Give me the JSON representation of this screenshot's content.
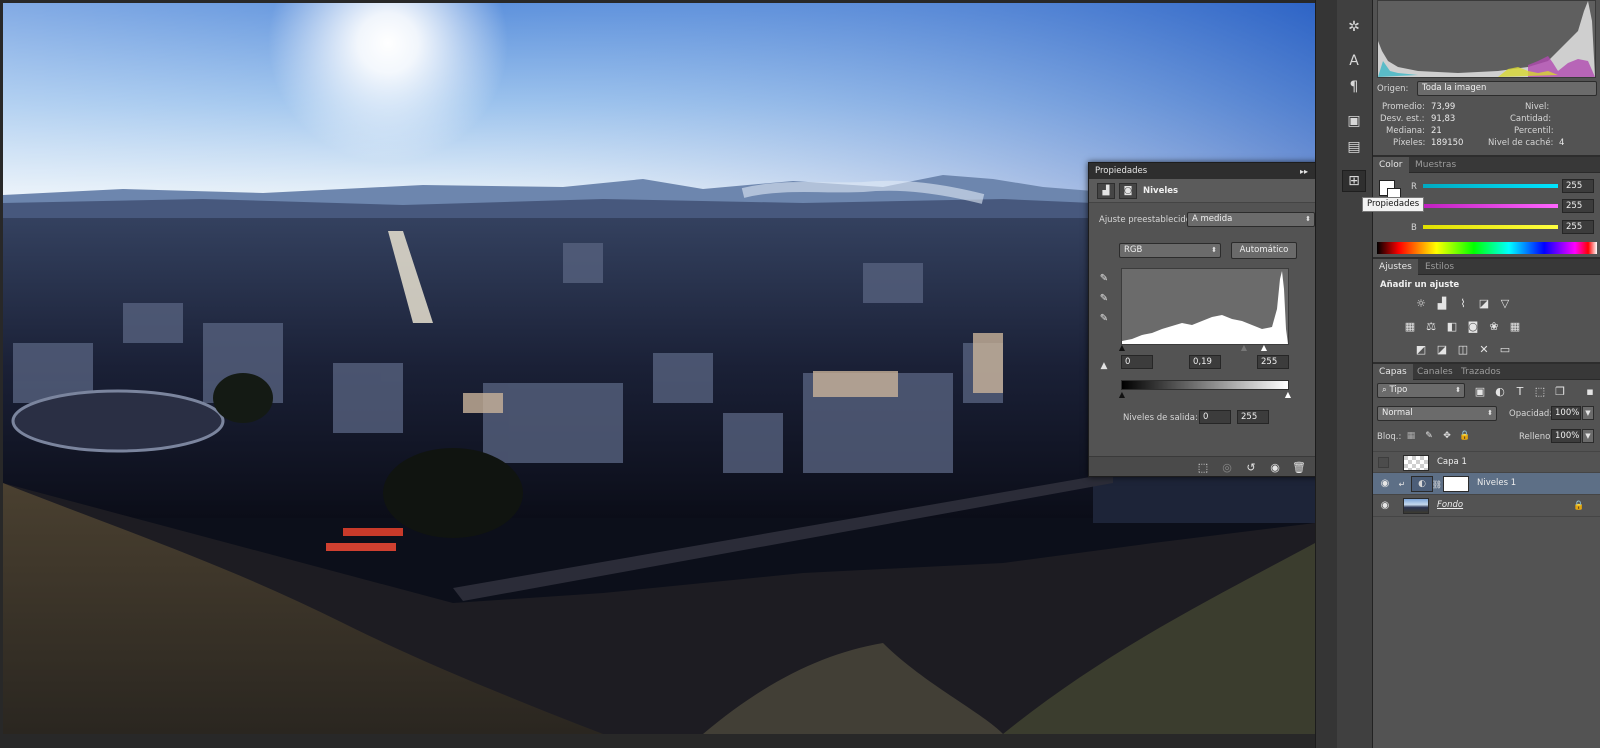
{
  "canvas": {
    "description_name": "city-landscape-photo"
  },
  "toolstrip": {
    "icons": [
      "gear-icon",
      "character-icon",
      "paragraph-icon",
      "library-icon",
      "notes-icon",
      "properties-icon"
    ]
  },
  "tooltip": {
    "text": "Propiedades"
  },
  "histogram": {
    "origin_label": "Origen:",
    "origin_value": "Toda la imagen",
    "stats": {
      "promedio_label": "Promedio:",
      "promedio": "73,99",
      "desv_label": "Desv. est.:",
      "desv": "91,83",
      "mediana_label": "Mediana:",
      "mediana": "21",
      "pixeles_label": "Píxeles:",
      "pixeles": "189150",
      "nivel_label": "Nivel:",
      "nivel": "",
      "cantidad_label": "Cantidad:",
      "cantidad": "",
      "percentil_label": "Percentil:",
      "percentil": "",
      "cache_label": "Nivel de caché:",
      "cache": "4"
    }
  },
  "color_panel": {
    "tabs": [
      "Color",
      "Muestras"
    ],
    "channels": [
      {
        "name": "R",
        "value": "255",
        "color": "#00e5ff"
      },
      {
        "name": "G",
        "value": "255",
        "color": "#ff33ff"
      },
      {
        "name": "B",
        "value": "255",
        "color": "#ffff00"
      }
    ]
  },
  "adjustments_panel": {
    "tabs": [
      "Ajustes",
      "Estilos"
    ],
    "heading": "Añadir un ajuste"
  },
  "layers_panel": {
    "tabs": [
      "Capas",
      "Canales",
      "Trazados"
    ],
    "filter_value": "Tipo",
    "blend_mode": "Normal",
    "opacity_label": "Opacidad:",
    "opacity_value": "100%",
    "lock_label": "Bloq.:",
    "fill_label": "Relleno:",
    "fill_value": "100%",
    "layers": [
      {
        "name": "Capa 1",
        "visible": false,
        "selected": false
      },
      {
        "name": "Niveles 1",
        "visible": true,
        "selected": true
      },
      {
        "name": "Fondo",
        "visible": true,
        "selected": false
      }
    ]
  },
  "properties_panel": {
    "title": "Propiedades",
    "adjustment_name": "Niveles",
    "preset_label": "Ajuste preestablecido:",
    "preset_value": "A medida",
    "channel_value": "RGB",
    "auto_label": "Automático",
    "input_black": "0",
    "input_gamma": "0,19",
    "input_white": "255",
    "output_label": "Niveles de salida:",
    "output_black": "0",
    "output_white": "255"
  }
}
